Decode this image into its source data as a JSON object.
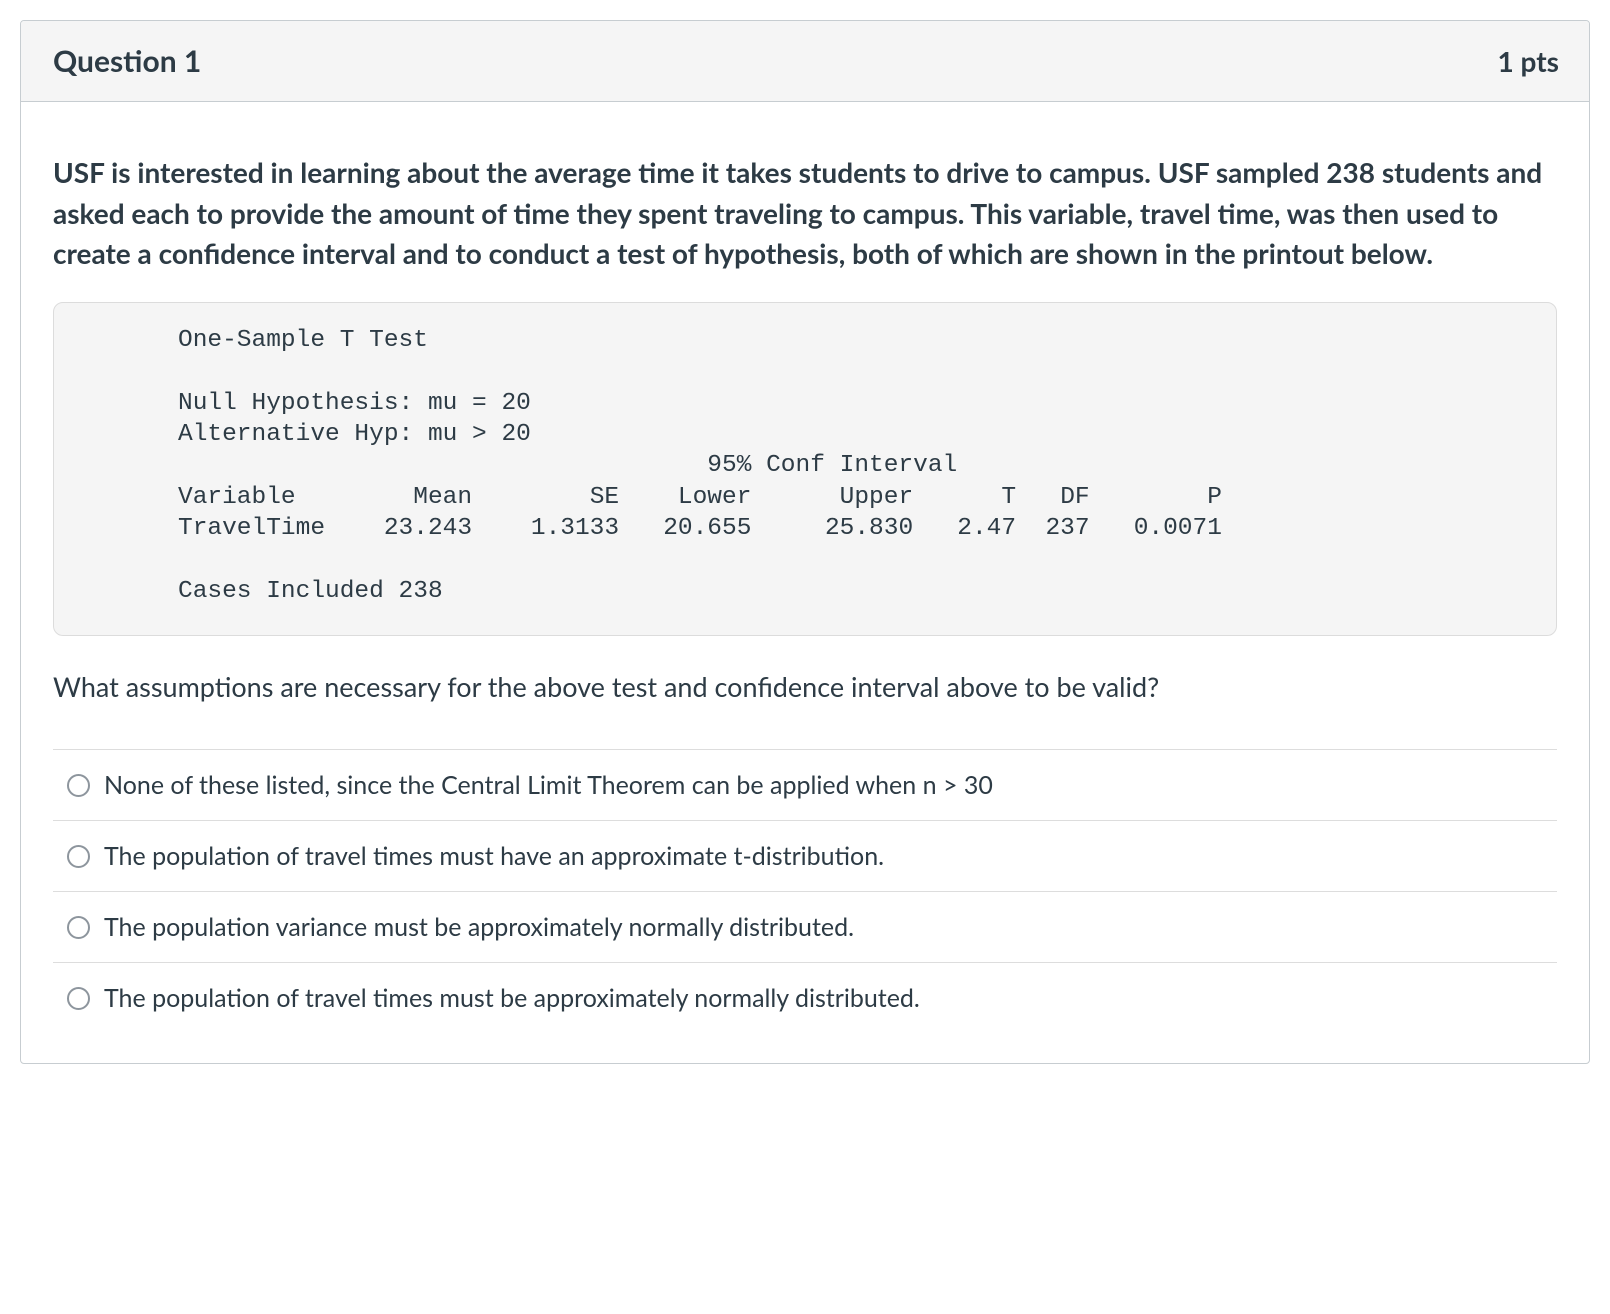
{
  "header": {
    "title": "Question 1",
    "points": "1 pts"
  },
  "stem": "USF is interested in learning about the average time it takes students to drive to campus. USF sampled 238 students and asked each to provide the amount of time they spent traveling to campus. This variable, travel time, was then used to create a confidence interval and to conduct a test of hypothesis, both of which are shown in the printout below.",
  "printout": {
    "title": "One-Sample T Test",
    "null_hyp": "Null Hypothesis: mu = 20",
    "alt_hyp": "Alternative Hyp: mu > 20",
    "ci_header": "95% Conf Interval",
    "columns": [
      "Variable",
      "Mean",
      "SE",
      "Lower",
      "Upper",
      "T",
      "DF",
      "P"
    ],
    "row": {
      "variable": "TravelTime",
      "mean": "23.243",
      "se": "1.3133",
      "lower": "20.655",
      "upper": "25.830",
      "t": "2.47",
      "df": "237",
      "p": "0.0071"
    },
    "cases": "Cases Included 238"
  },
  "followup": "What assumptions are necessary for the above test and confidence interval above to be valid?",
  "answers": [
    "None of these listed, since the Central Limit Theorem can be applied when n > 30",
    "The population of travel times must have an approximate t-distribution.",
    "The population variance must be approximately normally distributed.",
    "The population of travel times must be approximately normally distributed."
  ]
}
